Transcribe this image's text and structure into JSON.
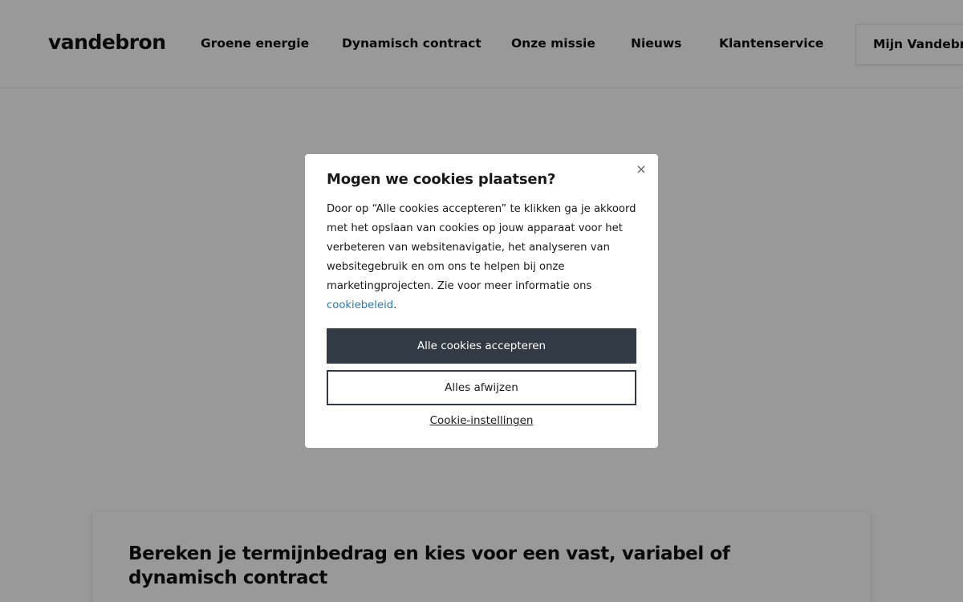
{
  "header": {
    "logo": "vandebron",
    "nav": [
      {
        "label": "Groene energie"
      },
      {
        "label": "Dynamisch contract"
      },
      {
        "label": "Onze missie"
      },
      {
        "label": "Nieuws"
      },
      {
        "label": "Klantenservice"
      }
    ],
    "account_button": "Mijn Vandebron"
  },
  "calculator": {
    "title": "Bereken je termijnbedrag en kies voor een vast, variabel of dynamisch contract"
  },
  "cookie_modal": {
    "title": "Mogen we cookies plaatsen?",
    "body_text": "Door op “Alle cookies accepteren” te klikken ga je akkoord met het opslaan van cookies op jouw apparaat voor het verbeteren van websitenavigatie, het analyseren van websitegebruik en om ons te helpen bij onze marketingprojecten. Zie voor meer informatie ons",
    "policy_link": "cookiebeleid",
    "body_suffix": ".",
    "accept_button": "Alle cookies accepteren",
    "reject_button": "Alles afwijzen",
    "settings_link": "Cookie-instellingen",
    "close_icon": "close-icon"
  },
  "colors": {
    "primary_button": "#313a45",
    "link": "#2a7ab8",
    "overlay": "rgba(0,0,0,0.40)"
  }
}
